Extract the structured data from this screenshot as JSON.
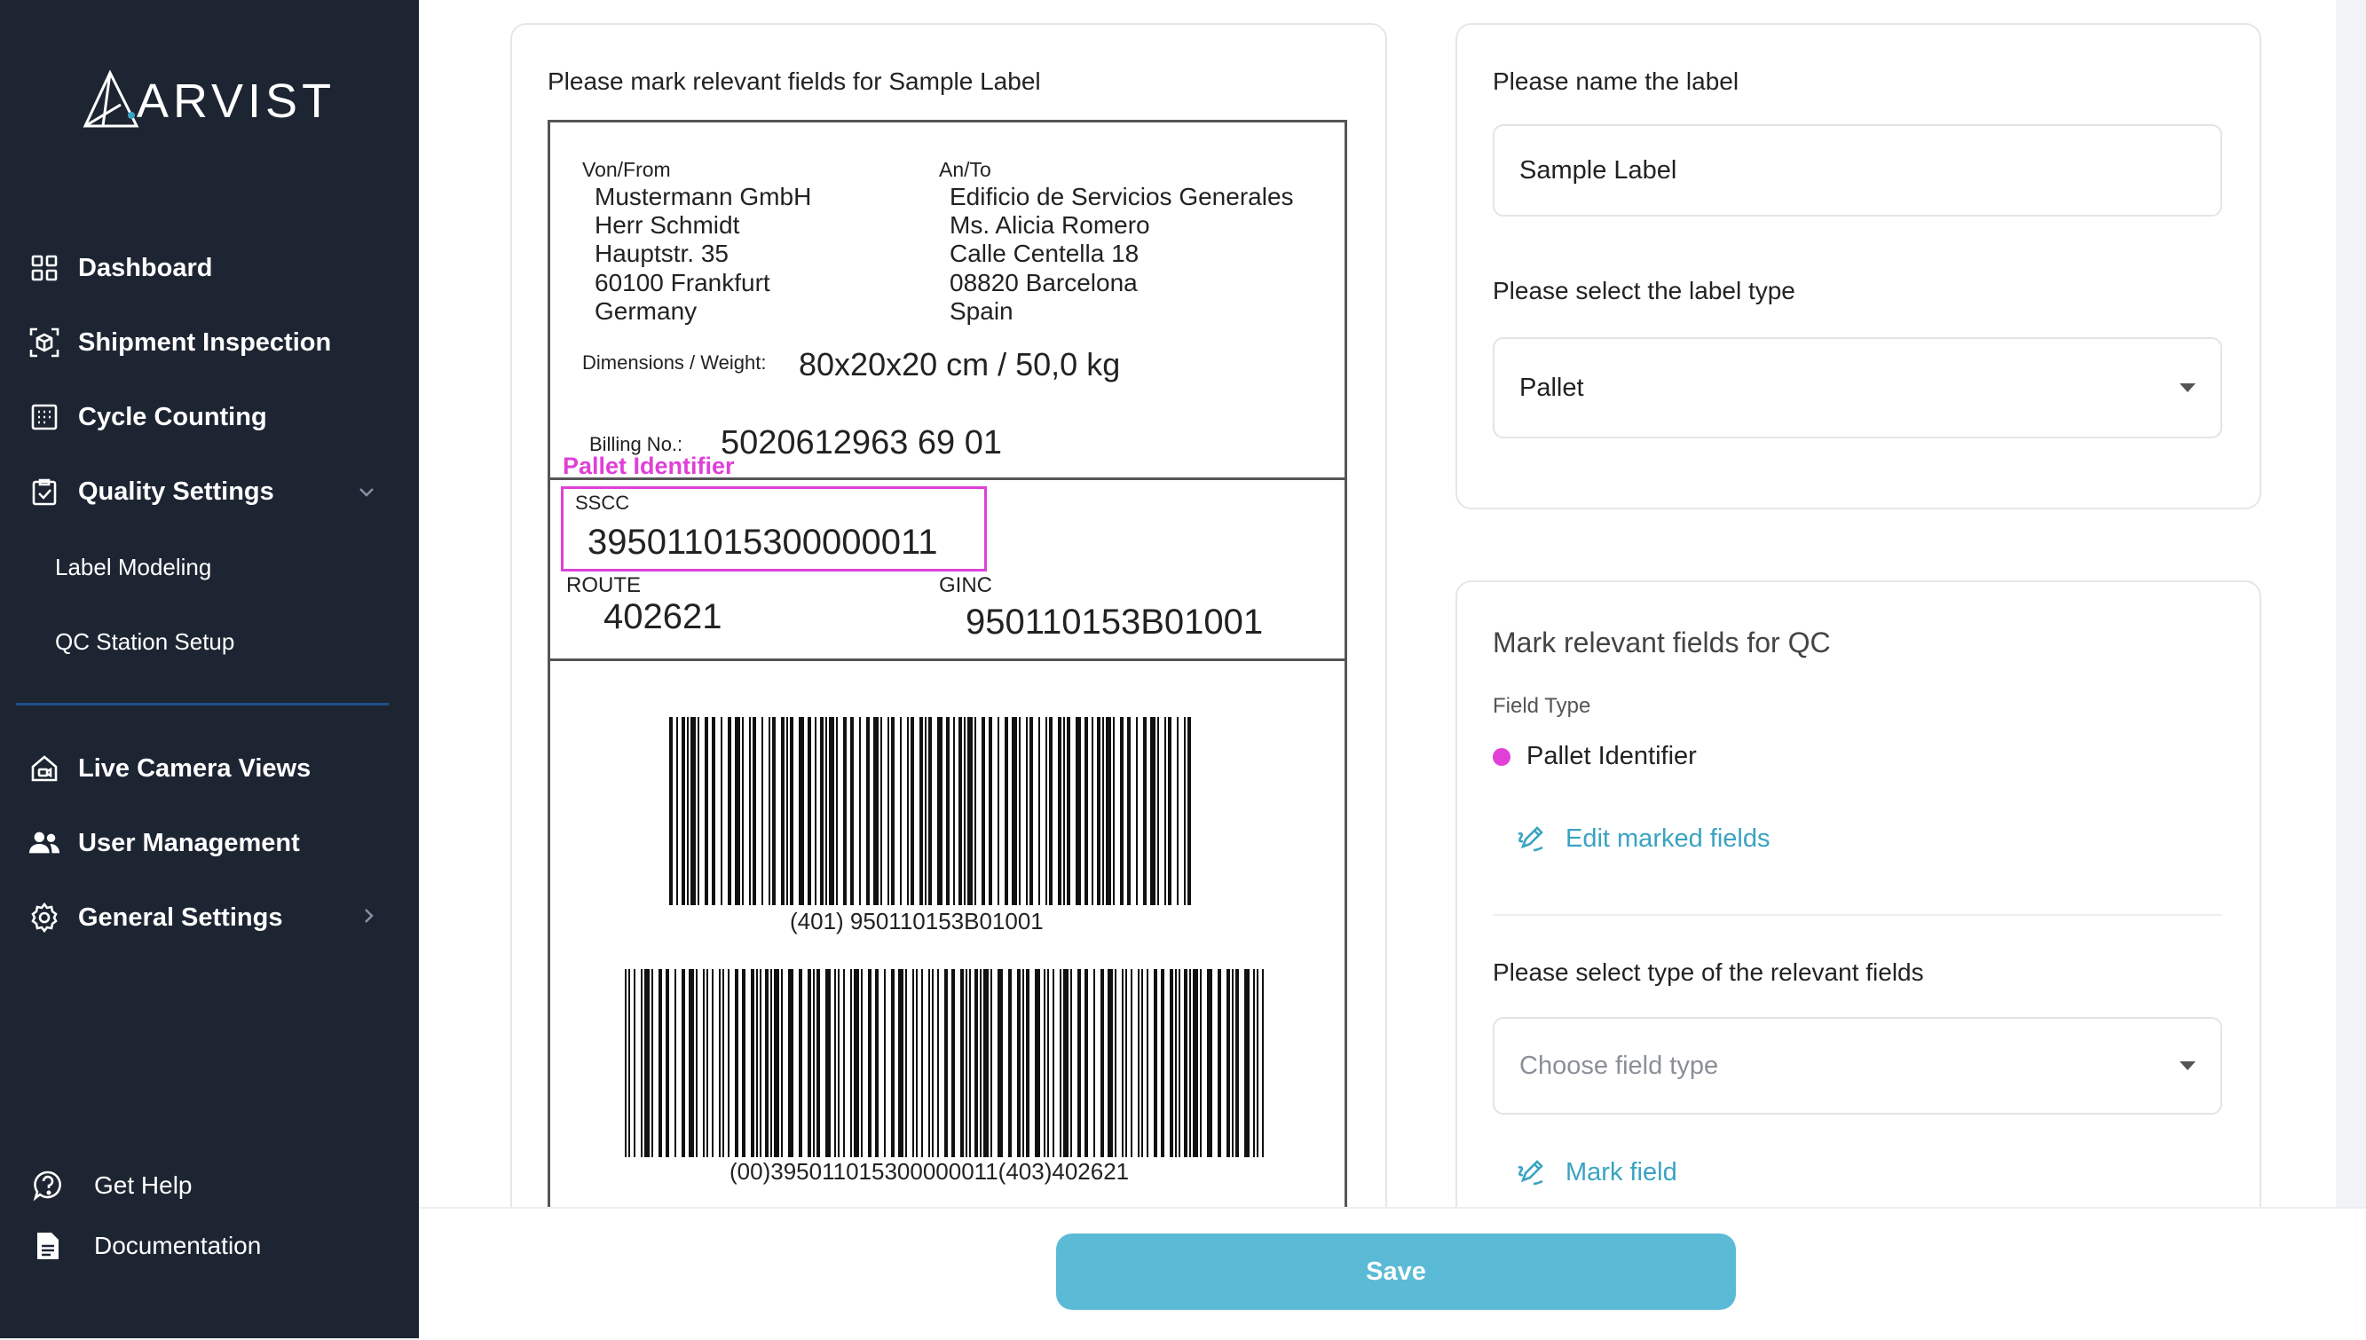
{
  "brand": {
    "name": "ARVIST"
  },
  "sidebar": {
    "items": [
      {
        "label": "Dashboard",
        "icon": "grid-icon"
      },
      {
        "label": "Shipment Inspection",
        "icon": "box-scan-icon"
      },
      {
        "label": "Cycle Counting",
        "icon": "calendar-grid-icon"
      },
      {
        "label": "Quality Settings",
        "icon": "clipboard-check-icon"
      },
      {
        "label": "Label Modeling"
      },
      {
        "label": "QC Station Setup"
      },
      {
        "label": "Live Camera Views",
        "icon": "home-camera-icon"
      },
      {
        "label": "User Management",
        "icon": "users-icon"
      },
      {
        "label": "General Settings",
        "icon": "gear-icon"
      }
    ],
    "bottom": [
      {
        "label": "Get Help",
        "icon": "help-icon"
      },
      {
        "label": "Documentation",
        "icon": "document-icon"
      }
    ]
  },
  "label_card": {
    "title": "Please mark relevant fields for Sample Label",
    "label": {
      "from_head": "Von/From",
      "from_lines": "Mustermann GmbH\nHerr Schmidt\nHauptstr. 35\n60100 Frankfurt\nGermany",
      "to_head": "An/To",
      "to_lines": "Edificio de Servicios Generales\nMs. Alicia Romero\nCalle Centella 18\n08820 Barcelona\nSpain",
      "dims_head": "Dimensions / Weight:",
      "dims_value": "80x20x20 cm / 50,0 kg",
      "billing_head": "Billing No.:",
      "billing_value": "5020612963 69 01",
      "sscc_head": "SSCC",
      "sscc_value": "395011015300000011",
      "route_head": "ROUTE",
      "route_value": "402621",
      "ginc_head": "GINC",
      "ginc_value": "950110153B01001",
      "barcode1_text": "(401) 950110153B01001",
      "barcode2_text": "(00)395011015300000011(403)402621"
    },
    "marked_field_caption": "Pallet Identifier"
  },
  "name_card": {
    "name_prompt": "Please name the label",
    "name_value": "Sample Label",
    "type_prompt": "Please select the label type",
    "type_value": "Pallet"
  },
  "qc_card": {
    "title": "Mark relevant fields for QC",
    "field_type_head": "Field Type",
    "field_type_item": "Pallet Identifier",
    "field_type_color": "#e040d8",
    "edit_link": "Edit marked fields",
    "select_prompt": "Please select type of the relevant fields",
    "select_placeholder": "Choose field type",
    "mark_link": "Mark field"
  },
  "footer": {
    "save_label": "Save"
  },
  "colors": {
    "sidebar_bg": "#1d2532",
    "accent": "#5bbad6",
    "link": "#3aa3c2",
    "mark": "#e040d8"
  }
}
